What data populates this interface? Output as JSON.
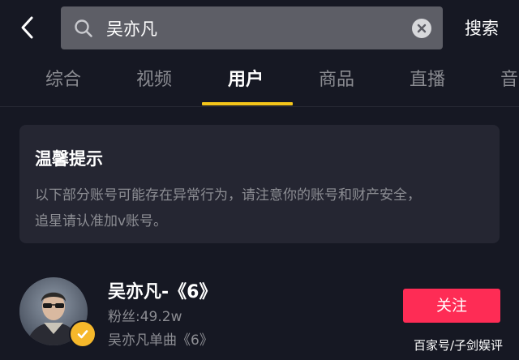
{
  "search": {
    "query": "吴亦凡",
    "submit_label": "搜索"
  },
  "tabs": [
    {
      "label": "综合",
      "active": false
    },
    {
      "label": "视频",
      "active": false
    },
    {
      "label": "用户",
      "active": true
    },
    {
      "label": "商品",
      "active": false
    },
    {
      "label": "直播",
      "active": false
    },
    {
      "label": "音",
      "active": false
    }
  ],
  "notice": {
    "title": "温馨提示",
    "line1": "以下部分账号可能存在异常行为，请注意你的账号和财产安全，",
    "line2": "追星请认准加v账号。"
  },
  "user_result": {
    "name": "吴亦凡-《6》",
    "fans": "粉丝:49.2w",
    "description": "吴亦凡单曲《6》",
    "follow_label": "关注",
    "verified": true
  },
  "watermark": "百家号/子剑娱评",
  "colors": {
    "background": "#161823",
    "search_box": "#5d5e66",
    "tab_indicator": "#f4c51a",
    "notice_card": "#252632",
    "follow_button": "#fe2c55",
    "verified_badge": "#f6b82b"
  },
  "icons": {
    "back": "chevron-left-icon",
    "search": "search-icon",
    "clear": "clear-icon",
    "verified": "verified-check-icon"
  }
}
